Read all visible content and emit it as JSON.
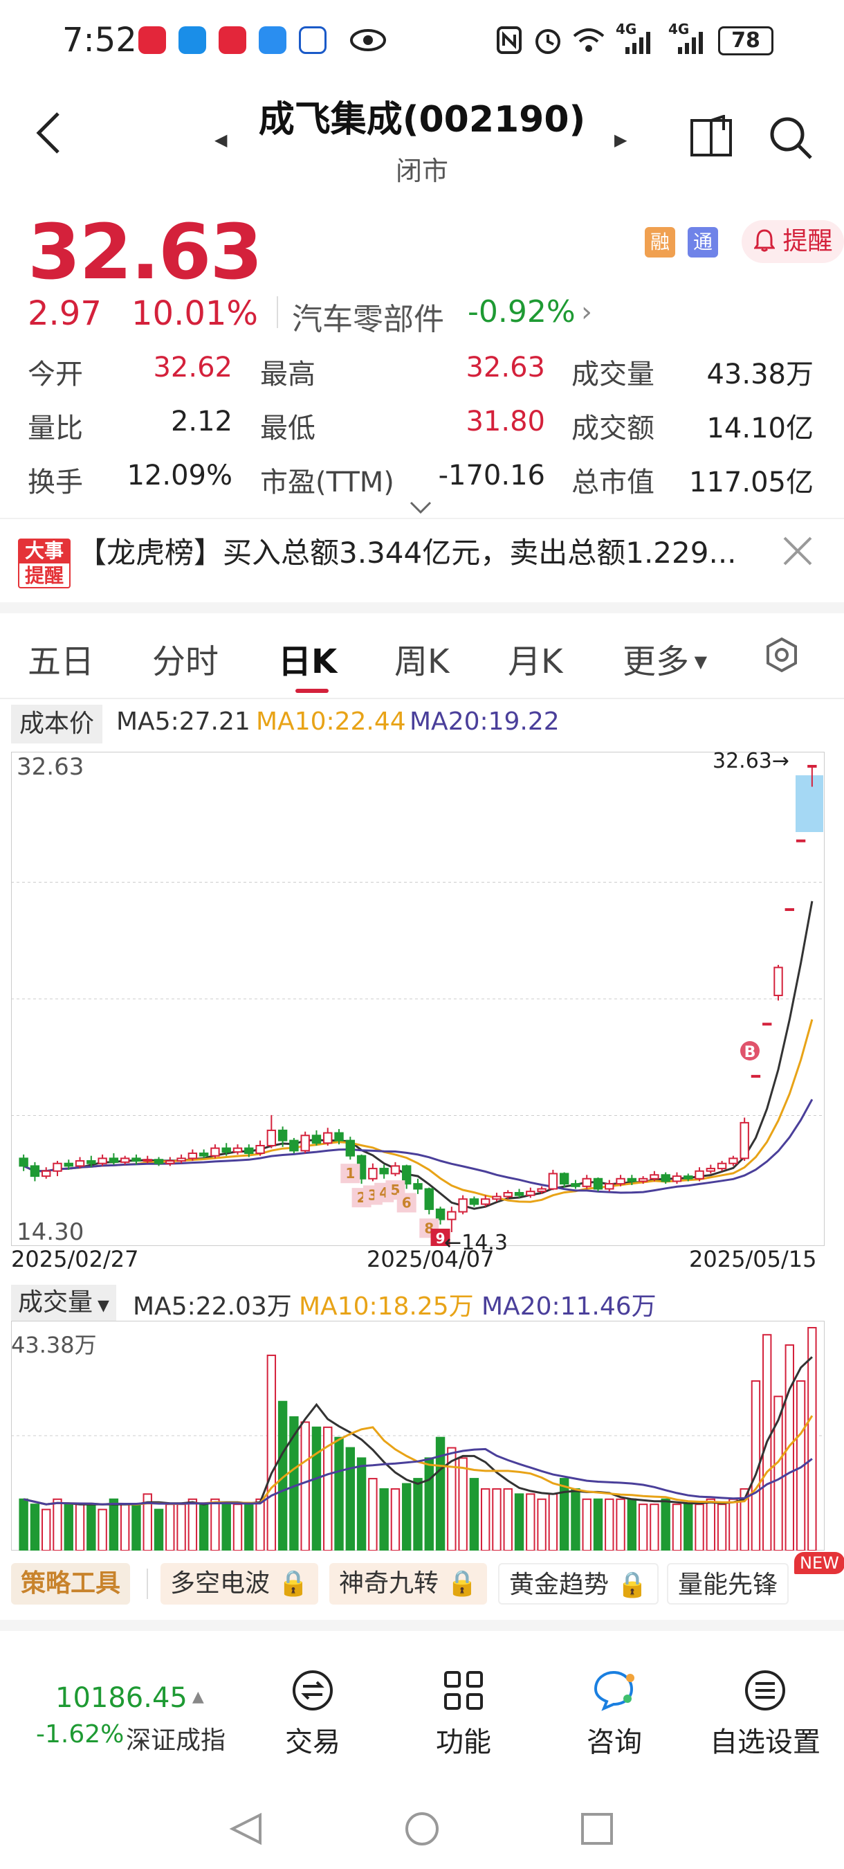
{
  "status_bar": {
    "time": "7:52",
    "network_1": "4G",
    "network_2": "4G",
    "battery": "78"
  },
  "header": {
    "title": "成飞集成(002190)",
    "subtitle": "闭市"
  },
  "quote": {
    "price": "32.63",
    "change": "2.97",
    "change_pct": "10.01%",
    "sector": "汽车零部件",
    "sector_change": "-0.92%",
    "badge_rong": "融",
    "badge_tong": "通",
    "remind_label": "提醒",
    "fields": [
      {
        "label": "今开",
        "value": "32.62"
      },
      {
        "label": "最高",
        "value": "32.63"
      },
      {
        "label": "成交量",
        "value": "43.38万"
      },
      {
        "label": "量比",
        "value": "2.12"
      },
      {
        "label": "最低",
        "value": "31.80"
      },
      {
        "label": "成交额",
        "value": "14.10亿"
      },
      {
        "label": "换手",
        "value": "12.09%"
      },
      {
        "label": "市盈(TTM)",
        "value": "-170.16"
      },
      {
        "label": "总市值",
        "value": "117.05亿"
      }
    ]
  },
  "news": {
    "badge_top": "大事",
    "badge_bottom": "提醒",
    "text": "【龙虎榜】买入总额3.344亿元，卖出总额1.229..."
  },
  "tabs": [
    {
      "label": "五日"
    },
    {
      "label": "分时"
    },
    {
      "label": "日K"
    },
    {
      "label": "周K"
    },
    {
      "label": "月K"
    },
    {
      "label": "更多"
    }
  ],
  "ma_bar": {
    "cost_label": "成本价",
    "ma5": "MA5:27.21",
    "ma10": "MA10:22.44",
    "ma20": "MA20:19.22"
  },
  "kline": {
    "top_value": "32.63",
    "bottom_value": "14.30",
    "high_mark": "32.63→",
    "low_mark": "←14.3",
    "date_start": "2025/02/27",
    "date_mid": "2025/04/07",
    "date_end": "2025/05/15",
    "b_marker": "B",
    "nine_turn": [
      "1",
      "2",
      "3",
      "4",
      "5",
      "6",
      "8",
      "9"
    ]
  },
  "volume": {
    "label": "成交量",
    "ma5": "MA5:22.03万",
    "ma10": "MA10:18.25万",
    "ma20": "MA20:11.46万",
    "top_value": "43.38万"
  },
  "tools": [
    {
      "label": "策略工具"
    },
    {
      "label": "多空电波"
    },
    {
      "label": "神奇九转"
    },
    {
      "label": "黄金趋势"
    },
    {
      "label": "量能先锋"
    }
  ],
  "new_tag": "NEW",
  "index": {
    "value": "10186.45",
    "change_pct": "-1.62%",
    "name": "深证成指"
  },
  "bottom_nav": [
    {
      "label": "交易"
    },
    {
      "label": "功能"
    },
    {
      "label": "咨询"
    },
    {
      "label": "自选设置"
    }
  ],
  "colors": {
    "up": "#d4213b",
    "down": "#1e9a33",
    "ma5": "#333333",
    "ma10": "#e8a317",
    "ma20": "#4a3f9a"
  },
  "chart_data": [
    {
      "type": "candlestick",
      "title": "",
      "x_range": [
        "2025/02/27",
        "2025/05/15"
      ],
      "ylim": [
        14.3,
        32.63
      ],
      "ma": {
        "MA5": 27.21,
        "MA10": 22.44,
        "MA20": 19.22
      },
      "candles": [
        {
          "o": 17.2,
          "c": 16.9,
          "h": 17.35,
          "l": 16.7
        },
        {
          "o": 16.9,
          "c": 16.5,
          "h": 17.05,
          "l": 16.3
        },
        {
          "o": 16.5,
          "c": 16.7,
          "h": 16.85,
          "l": 16.4
        },
        {
          "o": 16.7,
          "c": 17.0,
          "h": 17.1,
          "l": 16.5
        },
        {
          "o": 17.0,
          "c": 16.9,
          "h": 17.15,
          "l": 16.75
        },
        {
          "o": 16.9,
          "c": 17.1,
          "h": 17.25,
          "l": 16.8
        },
        {
          "o": 17.1,
          "c": 17.0,
          "h": 17.3,
          "l": 16.85
        },
        {
          "o": 17.0,
          "c": 17.2,
          "h": 17.35,
          "l": 16.9
        },
        {
          "o": 17.2,
          "c": 17.05,
          "h": 17.4,
          "l": 16.95
        },
        {
          "o": 17.05,
          "c": 17.2,
          "h": 17.3,
          "l": 16.95
        },
        {
          "o": 17.2,
          "c": 17.1,
          "h": 17.35,
          "l": 16.95
        },
        {
          "o": 17.1,
          "c": 17.15,
          "h": 17.3,
          "l": 17.0
        },
        {
          "o": 17.15,
          "c": 17.0,
          "h": 17.25,
          "l": 16.9
        },
        {
          "o": 17.0,
          "c": 17.1,
          "h": 17.25,
          "l": 16.9
        },
        {
          "o": 17.1,
          "c": 17.2,
          "h": 17.35,
          "l": 17.0
        },
        {
          "o": 17.2,
          "c": 17.4,
          "h": 17.55,
          "l": 17.1
        },
        {
          "o": 17.4,
          "c": 17.3,
          "h": 17.55,
          "l": 17.2
        },
        {
          "o": 17.3,
          "c": 17.6,
          "h": 17.75,
          "l": 17.2
        },
        {
          "o": 17.6,
          "c": 17.45,
          "h": 17.8,
          "l": 17.3
        },
        {
          "o": 17.45,
          "c": 17.6,
          "h": 17.75,
          "l": 17.35
        },
        {
          "o": 17.6,
          "c": 17.4,
          "h": 17.75,
          "l": 17.25
        },
        {
          "o": 17.4,
          "c": 17.7,
          "h": 17.9,
          "l": 17.3
        },
        {
          "o": 17.7,
          "c": 18.3,
          "h": 18.9,
          "l": 17.6
        },
        {
          "o": 18.3,
          "c": 17.9,
          "h": 18.45,
          "l": 17.65
        },
        {
          "o": 17.9,
          "c": 17.5,
          "h": 18.0,
          "l": 17.4
        },
        {
          "o": 17.5,
          "c": 18.1,
          "h": 18.25,
          "l": 17.4
        },
        {
          "o": 18.1,
          "c": 17.8,
          "h": 18.3,
          "l": 17.7
        },
        {
          "o": 17.8,
          "c": 18.2,
          "h": 18.4,
          "l": 17.7
        },
        {
          "o": 18.2,
          "c": 17.9,
          "h": 18.35,
          "l": 17.75
        },
        {
          "o": 17.9,
          "c": 17.3,
          "h": 18.05,
          "l": 17.15
        },
        {
          "o": 17.3,
          "c": 16.4,
          "h": 17.35,
          "l": 16.2
        },
        {
          "o": 16.4,
          "c": 16.8,
          "h": 17.0,
          "l": 16.3
        },
        {
          "o": 16.8,
          "c": 16.6,
          "h": 16.95,
          "l": 16.4
        },
        {
          "o": 16.6,
          "c": 16.9,
          "h": 17.05,
          "l": 16.5
        },
        {
          "o": 16.9,
          "c": 16.2,
          "h": 16.95,
          "l": 16.0
        },
        {
          "o": 16.2,
          "c": 16.0,
          "h": 16.4,
          "l": 15.8
        },
        {
          "o": 16.0,
          "c": 15.2,
          "h": 16.05,
          "l": 15.0
        },
        {
          "o": 15.2,
          "c": 14.8,
          "h": 15.3,
          "l": 14.6
        },
        {
          "o": 14.8,
          "c": 15.1,
          "h": 15.3,
          "l": 14.3
        },
        {
          "o": 15.1,
          "c": 15.6,
          "h": 15.75,
          "l": 15.0
        },
        {
          "o": 15.6,
          "c": 15.4,
          "h": 15.7,
          "l": 15.3
        },
        {
          "o": 15.4,
          "c": 15.6,
          "h": 15.75,
          "l": 15.3
        },
        {
          "o": 15.6,
          "c": 15.7,
          "h": 15.85,
          "l": 15.5
        },
        {
          "o": 15.7,
          "c": 15.85,
          "h": 15.95,
          "l": 15.6
        },
        {
          "o": 15.85,
          "c": 15.75,
          "h": 16.0,
          "l": 15.65
        },
        {
          "o": 15.75,
          "c": 15.9,
          "h": 16.05,
          "l": 15.65
        },
        {
          "o": 15.9,
          "c": 16.0,
          "h": 16.1,
          "l": 15.8
        },
        {
          "o": 16.0,
          "c": 16.6,
          "h": 16.75,
          "l": 15.95
        },
        {
          "o": 16.6,
          "c": 16.2,
          "h": 16.65,
          "l": 16.05
        },
        {
          "o": 16.2,
          "c": 16.1,
          "h": 16.35,
          "l": 16.0
        },
        {
          "o": 16.1,
          "c": 16.4,
          "h": 16.55,
          "l": 16.0
        },
        {
          "o": 16.4,
          "c": 16.0,
          "h": 16.45,
          "l": 15.9
        },
        {
          "o": 16.0,
          "c": 16.2,
          "h": 16.35,
          "l": 15.9
        },
        {
          "o": 16.2,
          "c": 16.4,
          "h": 16.55,
          "l": 16.1
        },
        {
          "o": 16.4,
          "c": 16.3,
          "h": 16.55,
          "l": 16.15
        },
        {
          "o": 16.3,
          "c": 16.4,
          "h": 16.5,
          "l": 16.2
        },
        {
          "o": 16.4,
          "c": 16.55,
          "h": 16.7,
          "l": 16.3
        },
        {
          "o": 16.55,
          "c": 16.3,
          "h": 16.65,
          "l": 16.2
        },
        {
          "o": 16.3,
          "c": 16.5,
          "h": 16.65,
          "l": 16.2
        },
        {
          "o": 16.5,
          "c": 16.4,
          "h": 16.6,
          "l": 16.3
        },
        {
          "o": 16.4,
          "c": 16.7,
          "h": 16.85,
          "l": 16.3
        },
        {
          "o": 16.7,
          "c": 16.8,
          "h": 16.95,
          "l": 16.6
        },
        {
          "o": 16.8,
          "c": 17.0,
          "h": 17.1,
          "l": 16.7
        },
        {
          "o": 17.0,
          "c": 17.2,
          "h": 17.3,
          "l": 16.9
        },
        {
          "o": 17.2,
          "c": 18.6,
          "h": 18.8,
          "l": 17.1
        },
        {
          "o": 20.45,
          "c": 20.45,
          "h": 20.45,
          "l": 20.45
        },
        {
          "o": 22.5,
          "c": 22.5,
          "h": 22.5,
          "l": 22.5
        },
        {
          "o": 23.6,
          "c": 24.7,
          "h": 24.8,
          "l": 23.4
        },
        {
          "o": 27.0,
          "c": 27.0,
          "h": 27.0,
          "l": 27.0
        },
        {
          "o": 29.7,
          "c": 29.7,
          "h": 29.7,
          "l": 29.7
        },
        {
          "o": 32.62,
          "c": 32.63,
          "h": 32.63,
          "l": 31.8
        }
      ]
    },
    {
      "type": "bar",
      "title": "",
      "ylim": [
        0,
        43.38
      ],
      "unit": "万",
      "values": [
        10,
        9,
        8,
        10,
        9,
        9,
        9,
        8,
        10,
        9,
        9,
        11,
        8,
        9,
        9,
        10,
        9,
        10,
        9,
        9,
        9,
        10,
        38,
        29,
        26,
        25,
        24,
        24,
        22,
        20,
        18,
        14,
        12,
        12,
        13,
        14,
        18,
        22,
        20,
        18,
        14,
        12,
        12,
        12,
        11,
        11,
        10,
        11,
        14,
        12,
        10,
        10,
        10,
        10,
        10,
        9,
        9,
        10,
        9,
        9,
        9,
        10,
        9,
        10,
        12,
        33,
        42,
        30,
        40,
        33,
        43.38
      ]
    }
  ]
}
